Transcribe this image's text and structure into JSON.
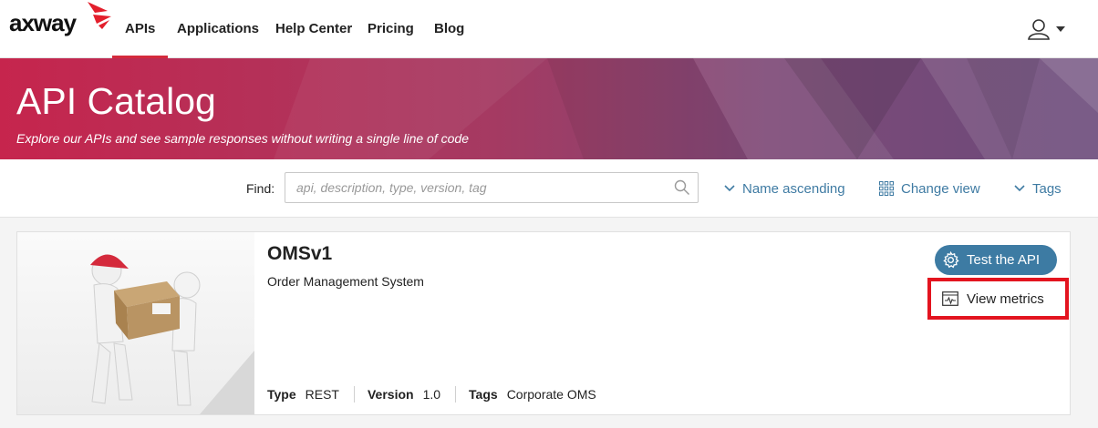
{
  "brand": {
    "logo_text": "axway",
    "accent": "#d42a3c"
  },
  "nav": {
    "items": [
      {
        "label": "APIs",
        "active": true
      },
      {
        "label": "Applications"
      },
      {
        "label": "Help Center"
      },
      {
        "label": "Pricing"
      },
      {
        "label": "Blog"
      }
    ],
    "user_icon": "user-icon"
  },
  "hero": {
    "title": "API Catalog",
    "subtitle": "Explore our APIs and see sample responses without writing a single line of code"
  },
  "toolbar": {
    "find_label": "Find:",
    "search_placeholder": "api, description, type, version, tag",
    "sort_label": "Name ascending",
    "view_label": "Change view",
    "tags_label": "Tags"
  },
  "api": {
    "name": "OMSv1",
    "description": "Order Management System",
    "type_label": "Type",
    "type_value": "REST",
    "version_label": "Version",
    "version_value": "1.0",
    "tags_label": "Tags",
    "tags_value": "Corporate OMS",
    "test_button": "Test the API",
    "metrics_button": "View metrics"
  },
  "colors": {
    "primary": "#3d7ba3",
    "highlight_border": "#e3141f"
  }
}
